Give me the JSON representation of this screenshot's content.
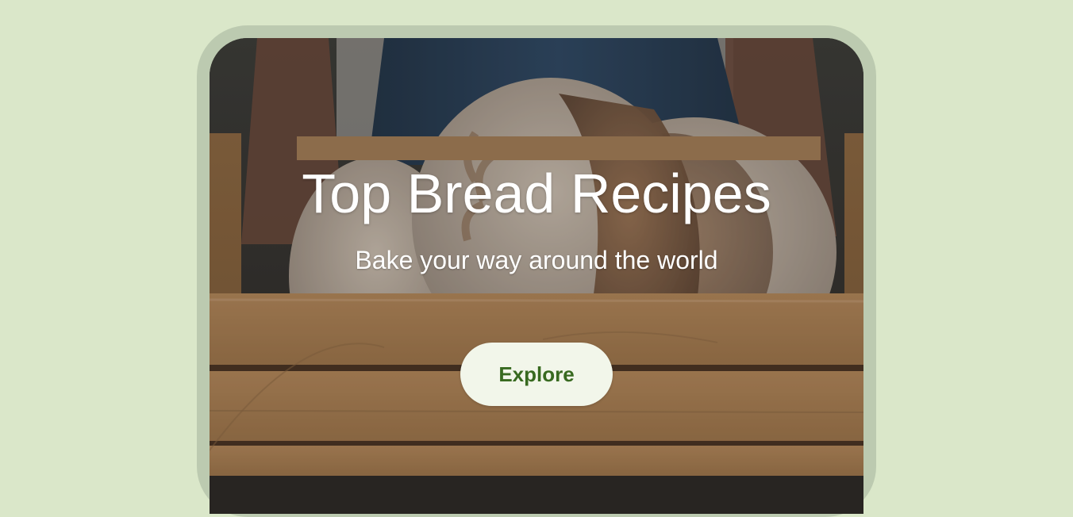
{
  "hero": {
    "title": "Top Bread Recipes",
    "subtitle": "Bake your way around the world",
    "button_label": "Explore",
    "image_subject": "bread-loaves-in-wooden-crate"
  },
  "colors": {
    "background": "#dae7c9",
    "device_frame": "#bccab0",
    "button_background": "#f2f6ea",
    "button_text": "#386a20",
    "text_on_image": "#ffffff"
  }
}
